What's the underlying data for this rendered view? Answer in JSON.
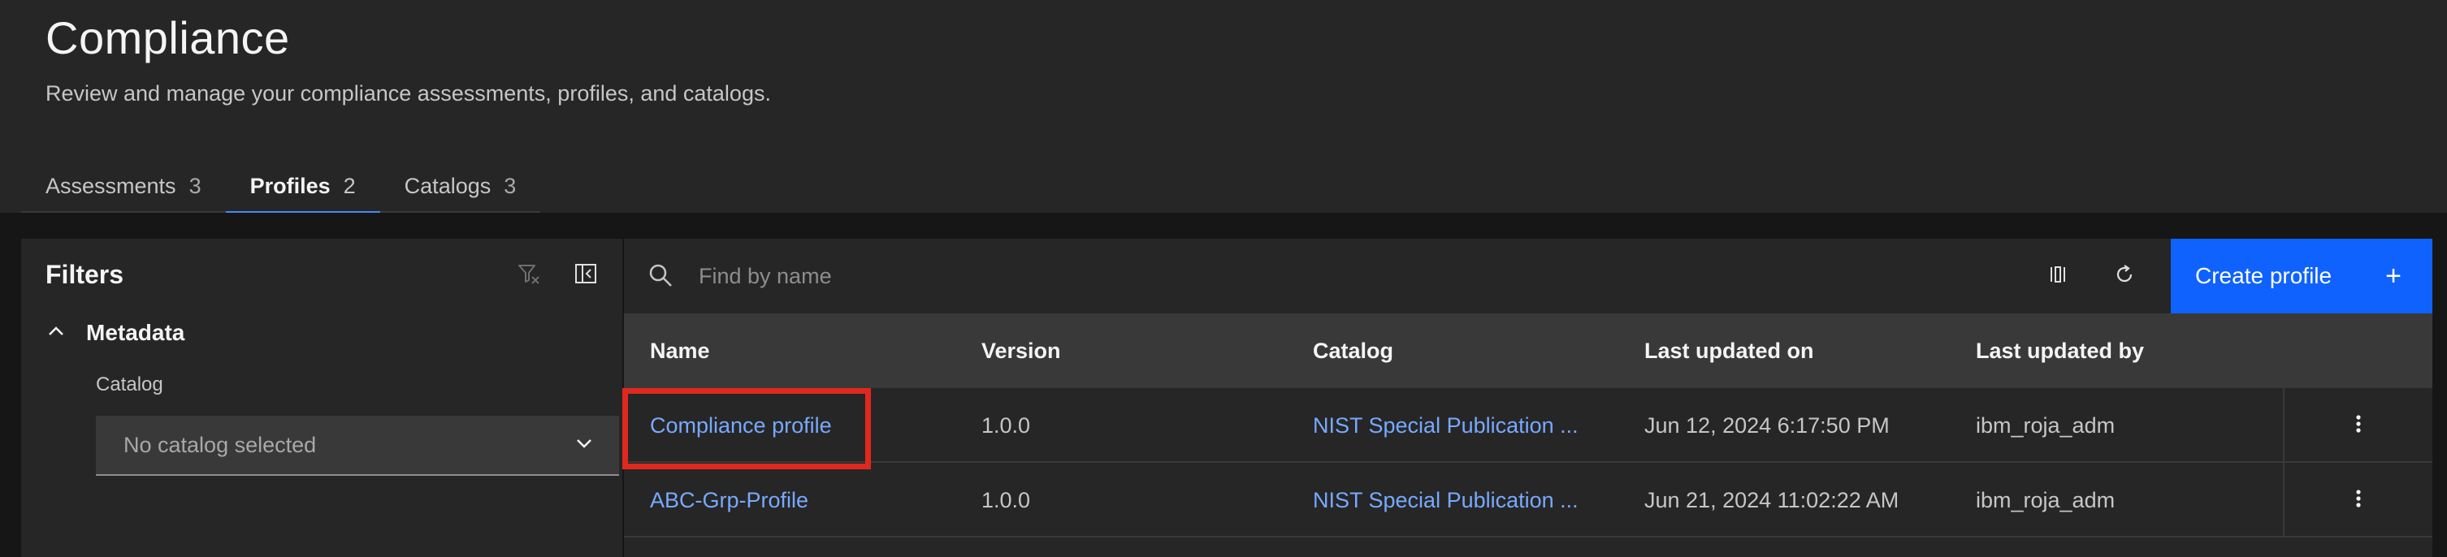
{
  "header": {
    "title": "Compliance",
    "subtitle": "Review and manage your compliance assessments, profiles, and catalogs."
  },
  "tabs": [
    {
      "label": "Assessments",
      "count": "3",
      "active": false
    },
    {
      "label": "Profiles",
      "count": "2",
      "active": true
    },
    {
      "label": "Catalogs",
      "count": "3",
      "active": false
    }
  ],
  "filters": {
    "title": "Filters",
    "section_label": "Metadata",
    "catalog_label": "Catalog",
    "catalog_value": "No catalog selected"
  },
  "toolbar": {
    "search_placeholder": "Find by name",
    "create_label": "Create profile",
    "create_icon": "+"
  },
  "table": {
    "columns": [
      "Name",
      "Version",
      "Catalog",
      "Last updated on",
      "Last updated by"
    ],
    "rows": [
      {
        "name": "Compliance profile",
        "version": "1.0.0",
        "catalog": "NIST Special Publication ...",
        "updated_on": "Jun 12, 2024 6:17:50 PM",
        "updated_by": "ibm_roja_adm"
      },
      {
        "name": "ABC-Grp-Profile",
        "version": "1.0.0",
        "catalog": "NIST Special Publication ...",
        "updated_on": "Jun 21, 2024 11:02:22 AM",
        "updated_by": "ibm_roja_adm"
      }
    ]
  },
  "colors": {
    "accent": "#0f62fe",
    "link": "#78a9ff",
    "highlight": "#e0281e"
  },
  "icons": [
    "filter-reset-icon",
    "collapse-panel-icon",
    "chevron-up-icon",
    "chevron-down-icon",
    "search-icon",
    "column-settings-icon",
    "refresh-icon",
    "add-icon",
    "overflow-menu-icon"
  ]
}
